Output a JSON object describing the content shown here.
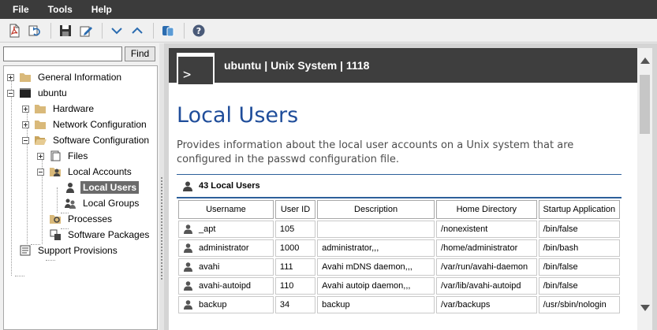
{
  "menu": {
    "file": "File",
    "tools": "Tools",
    "help": "Help"
  },
  "toolbar": {
    "icons": [
      "pdf-export-icon",
      "refresh-icon",
      "save-icon",
      "edit-icon",
      "collapse-all-icon",
      "expand-all-icon",
      "database-icon",
      "help-icon"
    ]
  },
  "search": {
    "value": "",
    "find_label": "Find"
  },
  "tree": {
    "general_information": "General Information",
    "ubuntu": "ubuntu",
    "hardware": "Hardware",
    "network_configuration": "Network Configuration",
    "software_configuration": "Software Configuration",
    "files": "Files",
    "local_accounts": "Local Accounts",
    "local_users": "Local Users",
    "local_groups": "Local Groups",
    "processes": "Processes",
    "software_packages": "Software Packages",
    "support_provisions": "Support Provisions"
  },
  "header": {
    "title": "ubuntu | Unix System | 1118",
    "terminal_glyph": ">"
  },
  "page": {
    "title": "Local Users",
    "description": "Provides information about the local user accounts on a Unix system that are configured in the passwd configuration file.",
    "count_label": "43 Local Users"
  },
  "table": {
    "columns": [
      "Username",
      "User ID",
      "Description",
      "Home Directory",
      "Startup Application"
    ],
    "rows": [
      [
        "_apt",
        "105",
        "",
        "/nonexistent",
        "/bin/false"
      ],
      [
        "administrator",
        "1000",
        "administrator,,,",
        "/home/administrator",
        "/bin/bash"
      ],
      [
        "avahi",
        "111",
        "Avahi mDNS daemon,,,",
        "/var/run/avahi-daemon",
        "/bin/false"
      ],
      [
        "avahi-autoipd",
        "110",
        "Avahi autoip daemon,,,",
        "/var/lib/avahi-autoipd",
        "/bin/false"
      ],
      [
        "backup",
        "34",
        "backup",
        "/var/backups",
        "/usr/sbin/nologin"
      ]
    ]
  },
  "colors": {
    "menubar": "#3b3b3b",
    "title": "#1f4d9a",
    "rule": "#2d5f9a",
    "selection": "#6b6b6b"
  }
}
